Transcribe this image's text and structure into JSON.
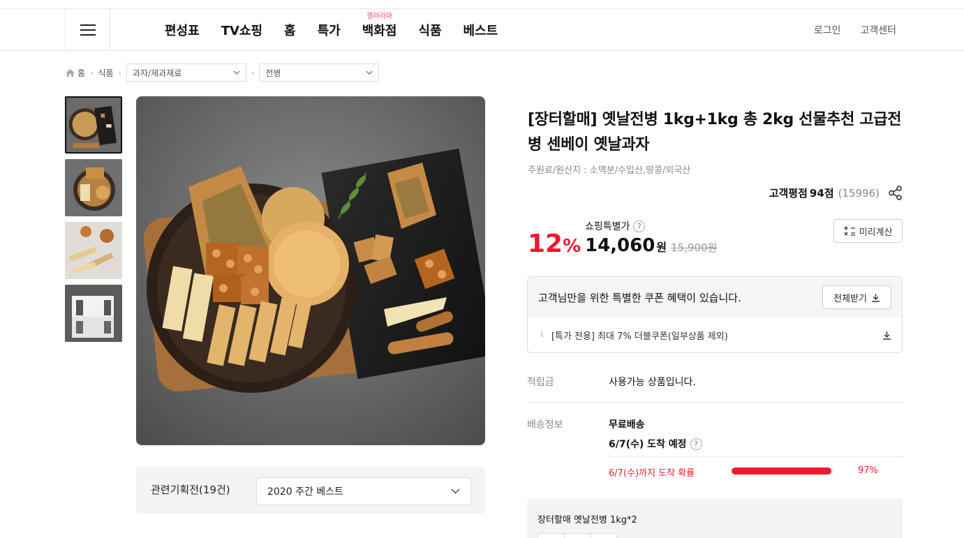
{
  "header": {
    "nav": [
      {
        "label": "편성표"
      },
      {
        "label": "TV쇼핑"
      },
      {
        "label": "홈"
      },
      {
        "label": "특가"
      },
      {
        "label": "백화점",
        "badge": "갤러리아"
      },
      {
        "label": "식품"
      },
      {
        "label": "베스트"
      }
    ],
    "util": {
      "login": "로그인",
      "support": "고객센터"
    }
  },
  "breadcrumb": {
    "home": "홈",
    "level1": "식품",
    "level2": "과자/제과재료",
    "level3": "전병"
  },
  "product": {
    "title": "[장터할매] 옛날전병 1kg+1kg 총 2kg 선물추천 고급전병 센베이 옛날과자",
    "origin": "주원료/원산지 : 소맥분/수입산,땅콩/외국산",
    "rating_label": "고객평점",
    "rating_score": "94점",
    "rating_count": "(15996)",
    "discount": "12",
    "discount_sign": "%",
    "price_label": "쇼핑특별가",
    "price": "14,060",
    "price_unit": "원",
    "price_original": "15,900원",
    "calc_label": "미리계산"
  },
  "coupon": {
    "title": "고객님만을 위한 특별한 쿠폰 혜택이 있습니다.",
    "download_all": "전체받기",
    "item": "[특가 전용] 최대 7% 더블쿠폰(일부상품 제외)"
  },
  "points": {
    "label": "적립금",
    "value": "사용가능 상품입니다."
  },
  "shipping": {
    "label": "배송정보",
    "type": "무료배송",
    "arrival": "6/7(수) 도착 예정",
    "prob_label": "6/7(수)까지 도착 확률",
    "prob_value": "97%",
    "prob_percent": 97
  },
  "related": {
    "label": "관련기획전(19건)",
    "selected": "2020 주간 베스트"
  },
  "option": {
    "name": "장터할매 옛날전병 1kg*2"
  },
  "colors": {
    "accent": "#f0182f",
    "badge": "#f0435a"
  }
}
